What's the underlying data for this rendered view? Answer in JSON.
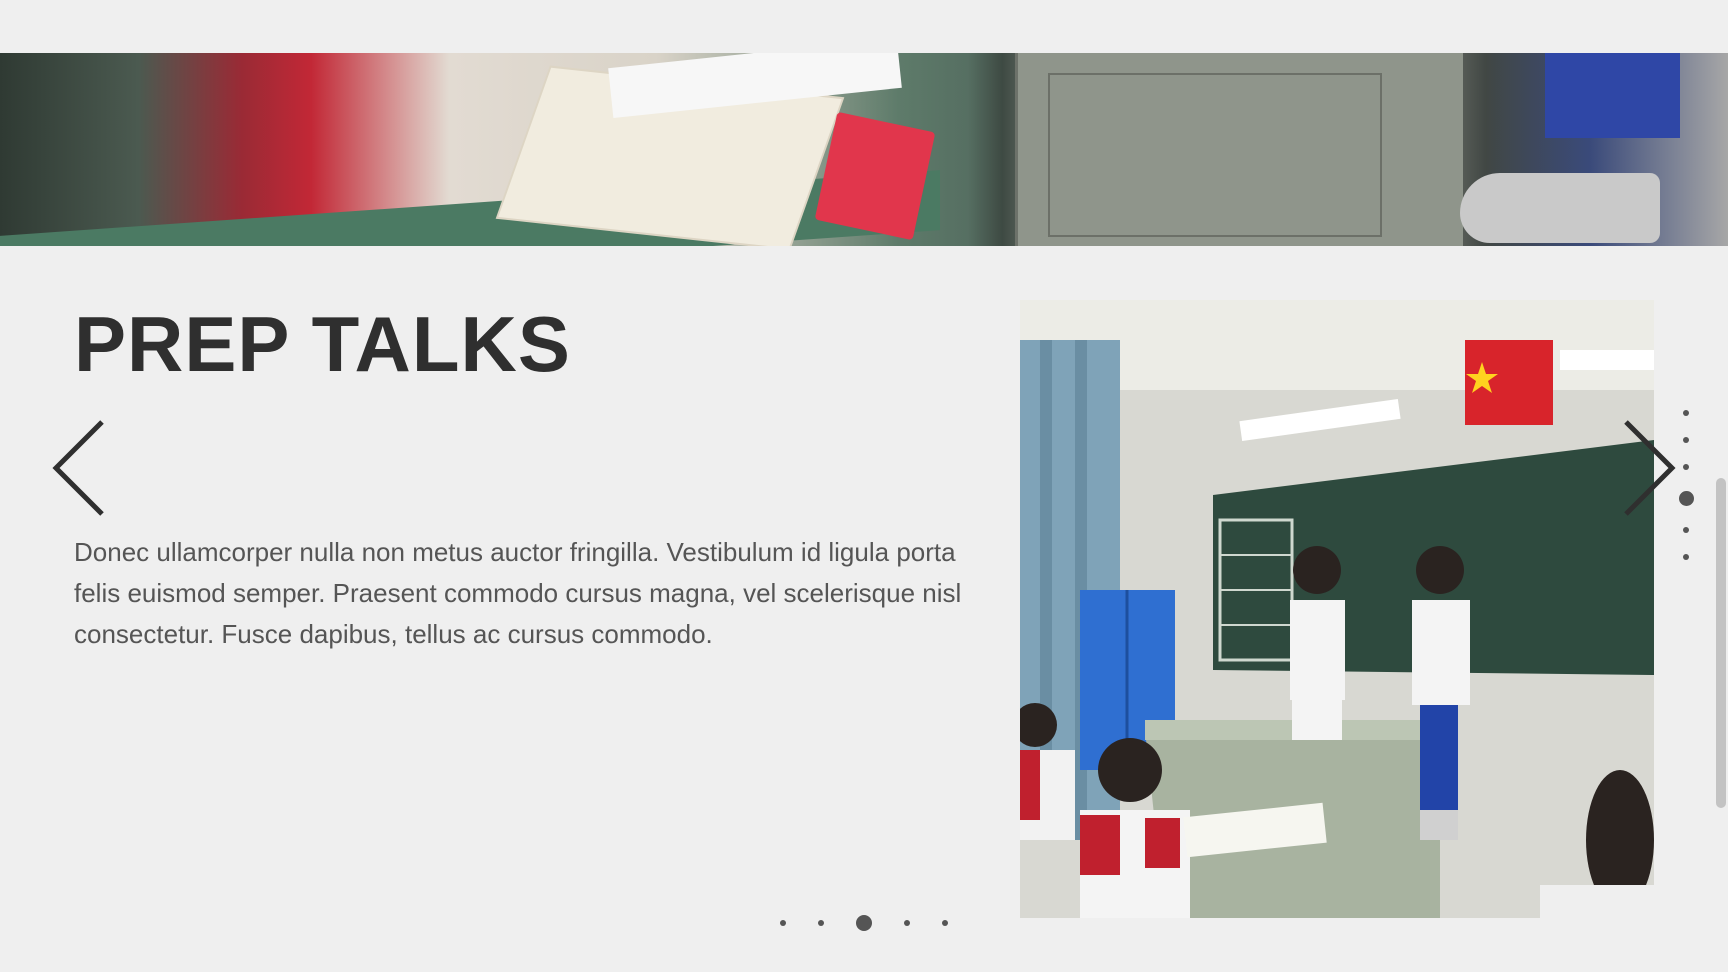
{
  "slide": {
    "title": "PREP TALKS",
    "body": "Donec ullamcorper nulla non metus auctor fringilla. Vestibulum id ligula porta felis euismod semper. Praesent commodo cursus magna, vel scelerisque nisl consectetur. Fusce dapibus, tellus ac cursus commodo."
  },
  "navigation": {
    "prev_icon": "chevron-left-icon",
    "next_icon": "chevron-right-icon",
    "horizontal_dots": {
      "count": 5,
      "active_index": 2
    },
    "vertical_dots": {
      "count": 6,
      "active_index": 3
    }
  },
  "images": {
    "banner": "classroom desk close-up with students",
    "photo": "two students presenting at the front of a classroom"
  },
  "colors": {
    "background": "#efefef",
    "title": "#2f2f2f",
    "body_text": "#555555",
    "dots": "#555555",
    "scrollbar": "#c3c3c3"
  }
}
